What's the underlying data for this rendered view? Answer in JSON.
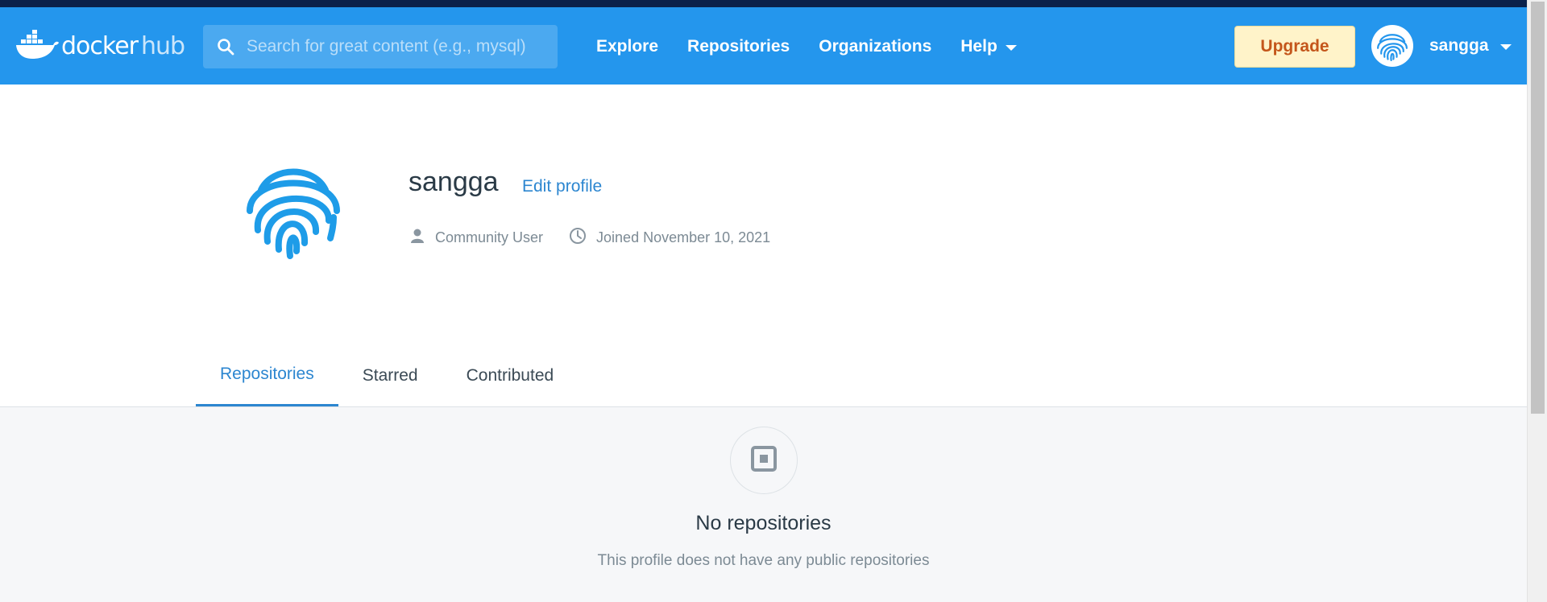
{
  "brand": {
    "logo_text": "docker",
    "logo_text_hub": "hub",
    "logo_icon": "docker-whale-icon"
  },
  "search": {
    "placeholder": "Search for great content (e.g., mysql)",
    "icon": "search-icon"
  },
  "nav": {
    "explore": "Explore",
    "repositories": "Repositories",
    "organizations": "Organizations",
    "help": "Help"
  },
  "header": {
    "upgrade_label": "Upgrade",
    "username": "sangga",
    "avatar_icon": "fingerprint-icon"
  },
  "profile": {
    "name": "sangga",
    "edit_label": "Edit profile",
    "role": "Community User",
    "joined": "Joined November 10, 2021",
    "avatar_icon": "fingerprint-icon"
  },
  "tabs": {
    "repositories": "Repositories",
    "starred": "Starred",
    "contributed": "Contributed",
    "active": "repositories"
  },
  "empty_state": {
    "icon": "repository-box-icon",
    "title": "No repositories",
    "subtitle": "This profile does not have any public repositories"
  },
  "colors": {
    "nav_bg": "#2496ed",
    "top_strip": "#0b214a",
    "accent": "#2c86d0",
    "upgrade_bg": "#fff3c9",
    "upgrade_text": "#c4561b",
    "content_bg": "#f6f7f9"
  }
}
